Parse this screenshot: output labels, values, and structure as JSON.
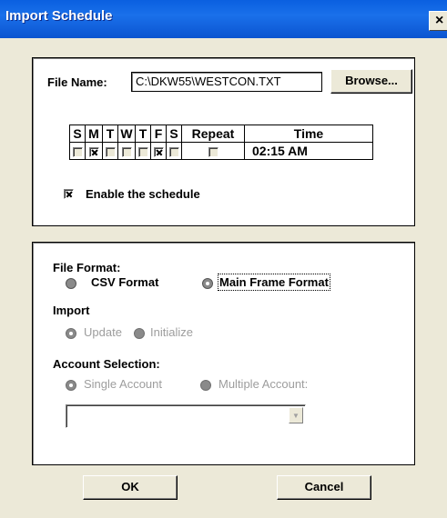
{
  "window": {
    "title": "Import Schedule",
    "close_glyph": "×"
  },
  "file": {
    "label": "File Name:",
    "value": "C:\\DKW55\\WESTCON.TXT",
    "browse_label": "Browse..."
  },
  "schedule": {
    "headers": [
      "S",
      "M",
      "T",
      "W",
      "T",
      "F",
      "S",
      "Repeat",
      "Time"
    ],
    "days_checked": [
      false,
      true,
      false,
      false,
      false,
      true,
      false
    ],
    "repeat_checked": false,
    "time": "02:15 AM"
  },
  "enable": {
    "label": "Enable the schedule",
    "checked": true
  },
  "format": {
    "label": "File Format:",
    "options": [
      "CSV Format",
      "Main Frame Format"
    ],
    "selected_index": 1
  },
  "import": {
    "label": "Import",
    "options": [
      "Update",
      "Initialize"
    ],
    "selected_index": 0
  },
  "account": {
    "label": "Account Selection:",
    "options": [
      "Single Account",
      "Multiple Account:"
    ],
    "selected_index": 0,
    "combo_value": ""
  },
  "buttons": {
    "ok": "OK",
    "cancel": "Cancel"
  },
  "icons": {
    "combo_arrow": "chevron-down-icon"
  }
}
